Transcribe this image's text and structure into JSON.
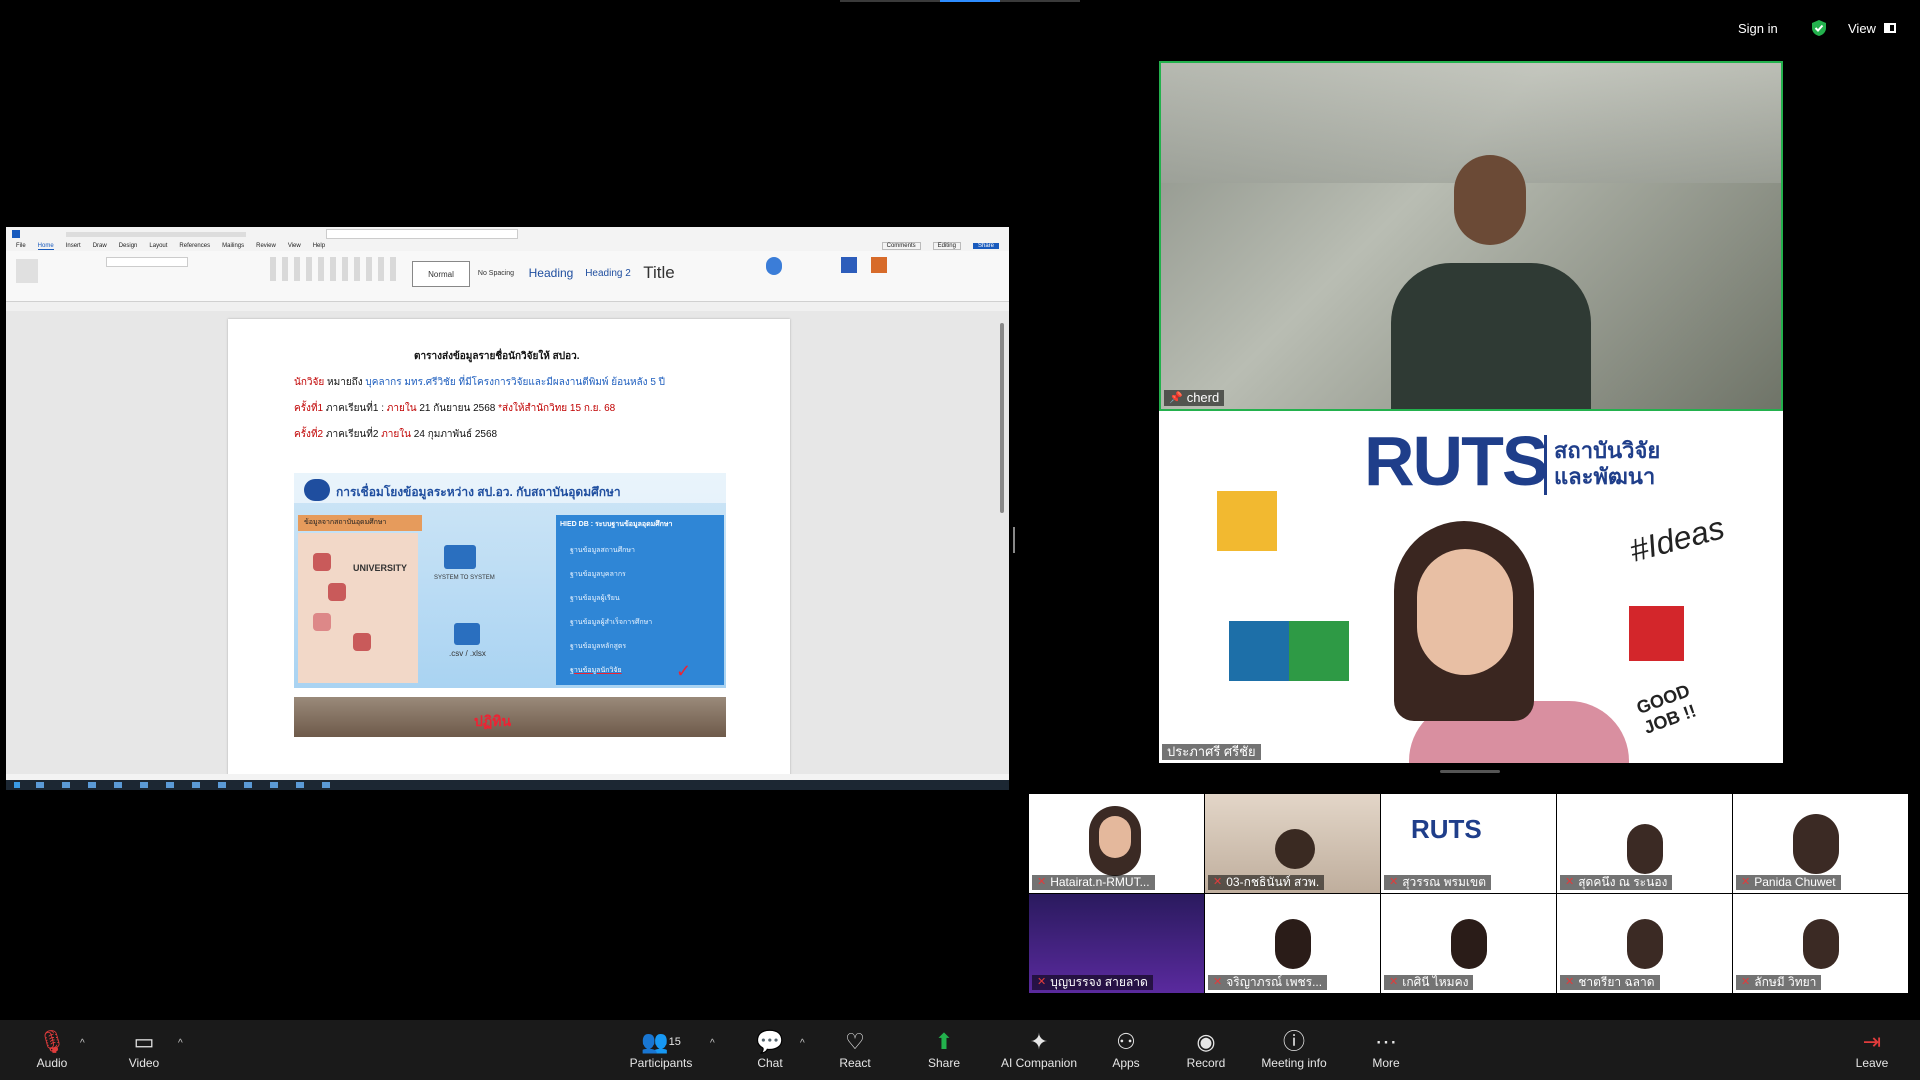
{
  "top": {
    "sign_in": "Sign in",
    "view": "View"
  },
  "word": {
    "menu": [
      "File",
      "Home",
      "Insert",
      "Draw",
      "Design",
      "Layout",
      "References",
      "Mailings",
      "Review",
      "View",
      "Help"
    ],
    "styles": [
      "Normal",
      "No Spacing",
      "Heading",
      "Heading 2",
      "Title"
    ],
    "comments": "Comments",
    "editing": "Editing",
    "share": "Share",
    "document": {
      "title": "ตารางส่งข้อมูลรายชื่อนักวิจัยให้ สปอว.",
      "line1_label": "นักวิจัย",
      "line1_text": "หมายถึง",
      "line1_rest": "บุคลากร มทร.ศรีวิชัย ที่มีโครงการวิจัยและมีผลงานตีพิมพ์ ย้อนหลัง 5 ปี",
      "line2_label": "ครั้งที่1",
      "line2_text": "ภาคเรียนที่1 :",
      "line2_in": "ภายใน",
      "line2_date": "21 กันยายน 2568",
      "line2_note": "*ส่งให้สำนักวิทย 15 ก.ย. 68",
      "line3_label": "ครั้งที่2",
      "line3_text": "ภาคเรียนที่2",
      "line3_in": "ภายใน",
      "line3_date": "24 กุมภาพันธ์ 2568",
      "slide_title": "การเชื่อมโยงข้อมูลระหว่าง สป.อว. กับสถาบันอุดมศึกษา",
      "slide_left_header": "ข้อมูลจากสถาบันอุดมศึกษา",
      "slide_university": "UNIVERSITY",
      "slide_system": "SYSTEM TO SYSTEM",
      "slide_csv": ".csv / .xlsx",
      "slide_right_header": "HIED DB : ระบบฐานข้อมูลอุดมศึกษา",
      "slide_items": [
        "ฐานข้อมูลสถานศึกษา",
        "ฐานข้อมูลบุคลากร",
        "ฐานข้อมูลผู้เรียน",
        "ฐานข้อมูลผู้สำเร็จการศึกษา",
        "ฐานข้อมูลหลักสูตร",
        "ฐานข้อมูลนักวิจัย"
      ],
      "slide2_text": "ปฏิทิน"
    }
  },
  "speakers": {
    "main_name": "cherd",
    "second_name": "ประภาศรี ศรีชัย",
    "rut_logo": "RUTS",
    "rut_thai1": "สถาบันวิจัย",
    "rut_thai2": "และพัฒนา",
    "ideas": "#Ideas",
    "good_job": "GOOD JOB !!"
  },
  "gallery": [
    {
      "name": "Hatairat.n-RMUT..."
    },
    {
      "name": "03-กชธินันท์ สวพ."
    },
    {
      "name": "สุวรรณ พรมเขต"
    },
    {
      "name": "สุดคนึง ณ ระนอง"
    },
    {
      "name": "Panida Chuwet"
    },
    {
      "name": "บุญบรรจง สายลาด"
    },
    {
      "name": "จริญาภรณ์ เพชร..."
    },
    {
      "name": "เกศินี ไหมคง"
    },
    {
      "name": "ชาตรียา ฉลาด"
    },
    {
      "name": "ลักษมี วิทยา"
    }
  ],
  "toolbar": {
    "audio": "Audio",
    "video": "Video",
    "participants": "Participants",
    "participants_count": "15",
    "chat": "Chat",
    "react": "React",
    "share": "Share",
    "ai": "AI Companion",
    "apps": "Apps",
    "record": "Record",
    "meeting_info": "Meeting info",
    "more": "More",
    "leave": "Leave"
  }
}
